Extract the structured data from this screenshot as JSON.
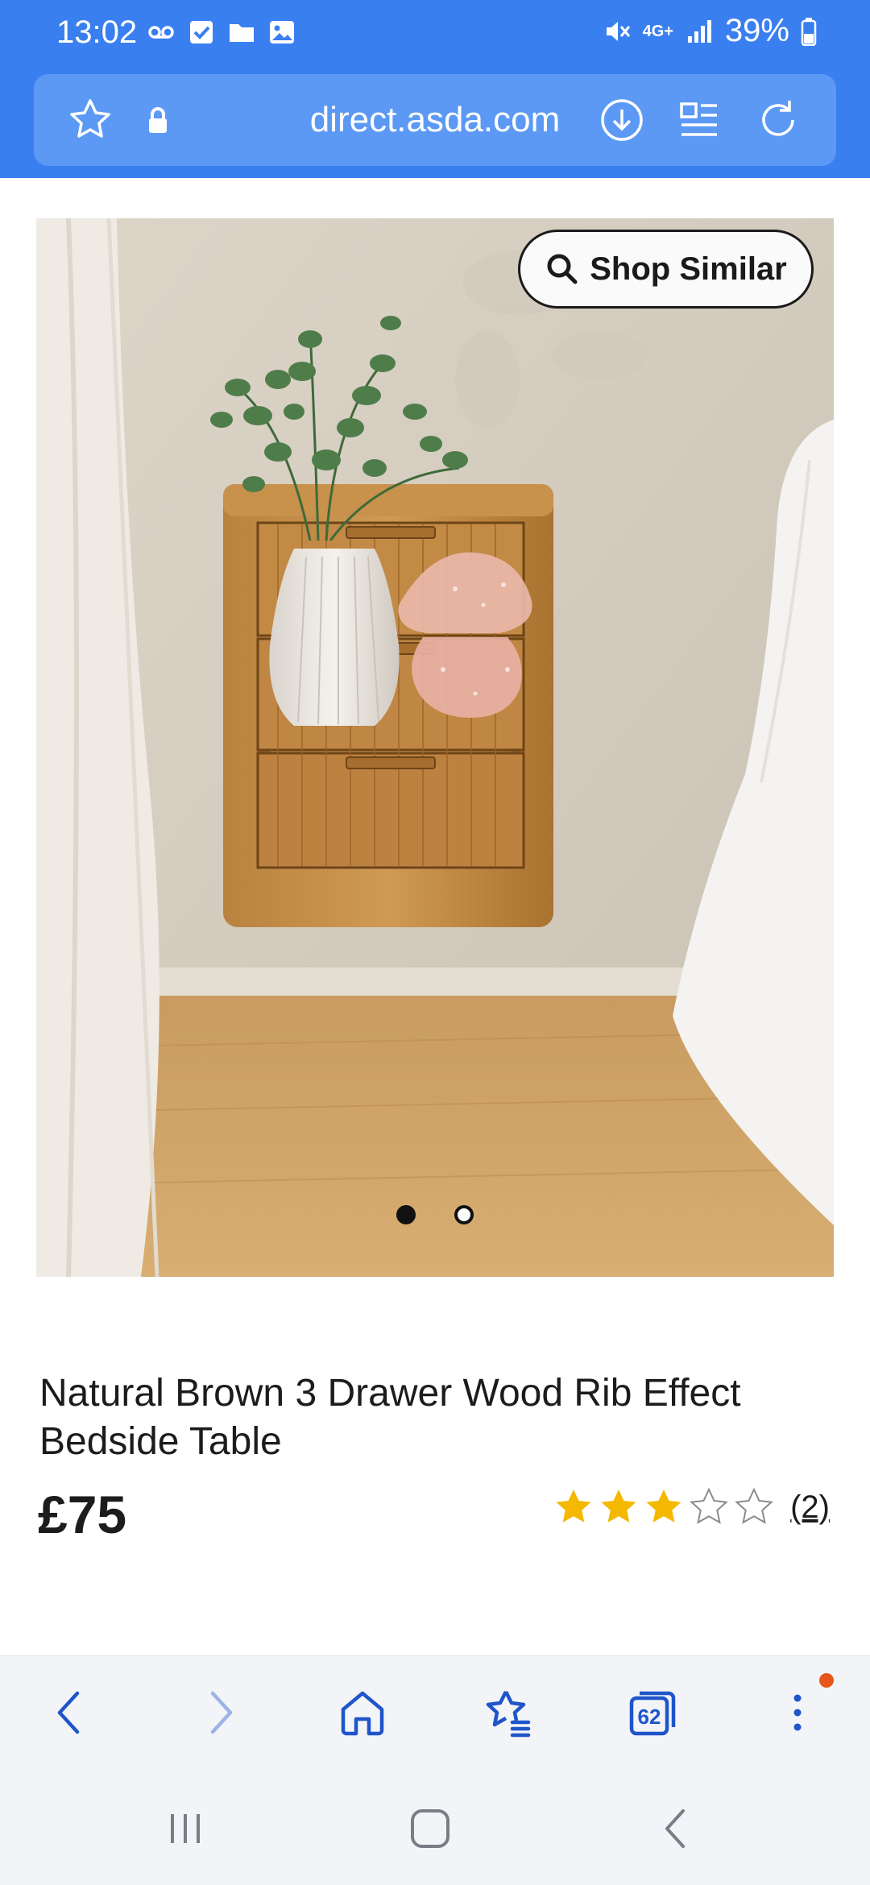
{
  "status_bar": {
    "time": "13:02",
    "network": "4G+",
    "battery": "39%"
  },
  "browser": {
    "url": "direct.asda.com",
    "tabs_count": "62",
    "accent_color": "#3a7ff0"
  },
  "product": {
    "shop_similar_label": "Shop Similar",
    "title": "Natural Brown 3 Drawer Wood Rib Effect Bedside Table",
    "price": "£75",
    "rating": 3,
    "rating_max": 5,
    "review_count": "(2)",
    "image_count": 2,
    "active_image": 1,
    "star_color": "#f5b800"
  }
}
